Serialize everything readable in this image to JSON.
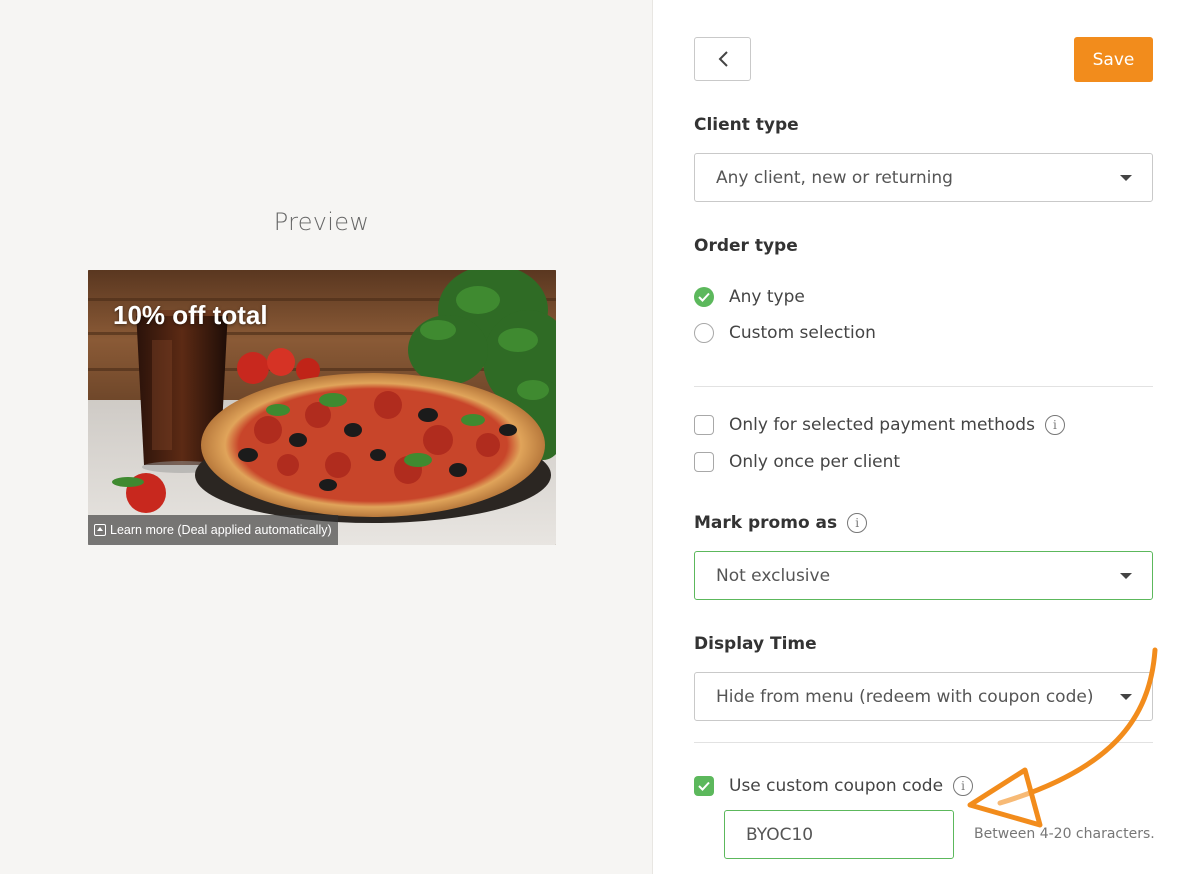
{
  "preview": {
    "title": "Preview",
    "banner_title": "10% off total",
    "learn_more": "Learn more (Deal applied automatically)"
  },
  "toolbar": {
    "back_icon": "chevron-left-icon",
    "save_label": "Save"
  },
  "client_type": {
    "label": "Client type",
    "value": "Any client, new or returning"
  },
  "order_type": {
    "label": "Order type",
    "options": [
      {
        "label": "Any type",
        "selected": true
      },
      {
        "label": "Custom selection",
        "selected": false
      }
    ]
  },
  "checks": {
    "payment_methods": {
      "label": "Only for selected payment methods",
      "checked": false
    },
    "once_per_client": {
      "label": "Only once per client",
      "checked": false
    }
  },
  "mark_promo": {
    "label": "Mark promo as",
    "value": "Not exclusive"
  },
  "display_time": {
    "label": "Display Time",
    "value": "Hide from menu (redeem with coupon code)"
  },
  "coupon": {
    "label": "Use custom coupon code",
    "checked": true,
    "value": "BYOC10",
    "hint": "Between 4-20 characters."
  },
  "colors": {
    "accent": "#f28c1c",
    "success": "#5cb85c",
    "annotation_arrow": "#f28c1c"
  }
}
